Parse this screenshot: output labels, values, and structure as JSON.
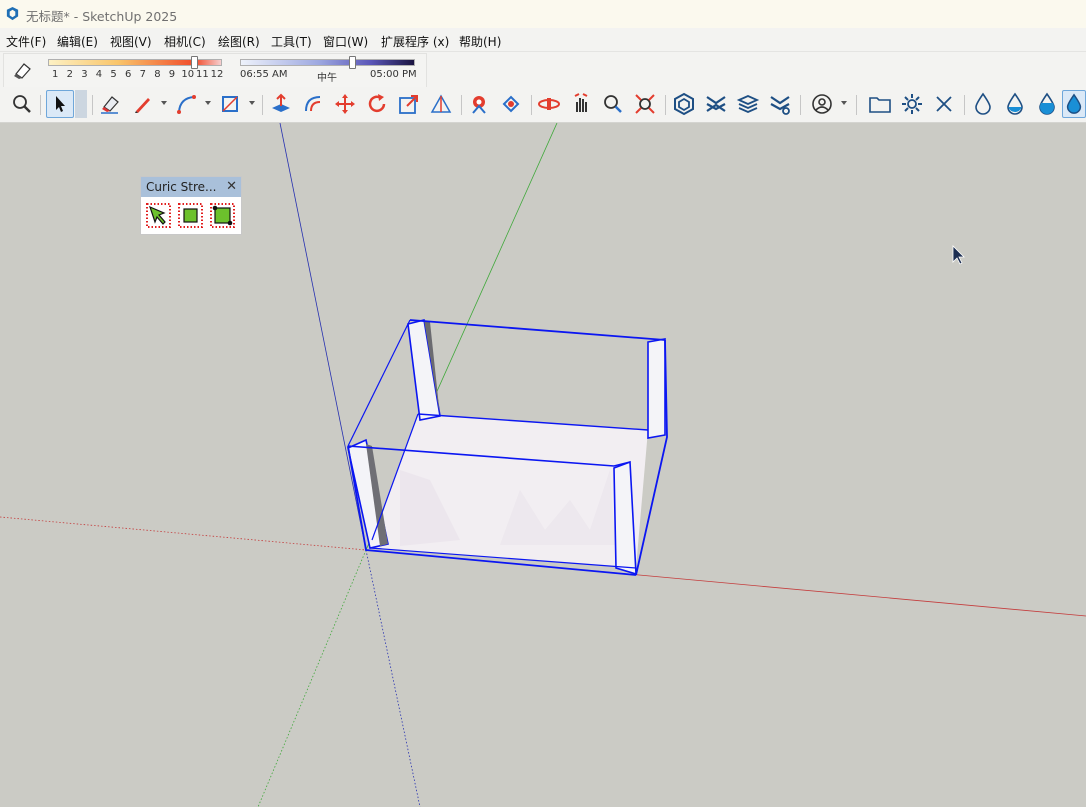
{
  "window": {
    "title": "无标题* - SketchUp 2025",
    "app_icon": "sketchup-logo-icon"
  },
  "menu": {
    "items": [
      {
        "label": "文件(F)"
      },
      {
        "label": "编辑(E)"
      },
      {
        "label": "视图(V)"
      },
      {
        "label": "相机(C)"
      },
      {
        "label": "绘图(R)"
      },
      {
        "label": "工具(T)"
      },
      {
        "label": "窗口(W)"
      },
      {
        "label": "扩展程序 (x)"
      },
      {
        "label": "帮助(H)"
      }
    ]
  },
  "shadow_settings": {
    "icon": "shadow-toggle-icon",
    "month_ticks": [
      "1",
      "2",
      "3",
      "4",
      "5",
      "6",
      "7",
      "8",
      "9",
      "10",
      "11",
      "12"
    ],
    "month_selected": 11,
    "time_start": "06:55 AM",
    "time_mid": "中午",
    "time_end": "05:00 PM",
    "time_position": 0.65,
    "colors": {
      "month_gradient_start": "#fdf1c4",
      "month_gradient_mid": "#f04a2a",
      "time_gradient_end": "#1a1440"
    }
  },
  "toolbar": {
    "tools": [
      "zoom-icon",
      "select-icon",
      "eraser-icon",
      "pencil-line-icon",
      "arc-icon",
      "rectangle-icon",
      "push-pull-icon",
      "offset-icon",
      "move-icon",
      "rotate-icon",
      "scale-icon",
      "protractor-icon",
      "paint-bucket-icon",
      "component-icon",
      "orbit-icon",
      "pan-icon",
      "zoom-window-icon",
      "zoom-extents-icon",
      "warehouse-icon",
      "extension-icon",
      "layers-icon",
      "outliner-icon",
      "profile-icon",
      "folder-icon",
      "gear-icon",
      "close-icon",
      "style-drop-1-icon",
      "style-drop-2-icon",
      "style-drop-3-icon",
      "style-drop-4-icon"
    ],
    "active_tool": "select-icon"
  },
  "curic_panel": {
    "title": "Curic Stre...",
    "buttons": [
      "stretch-select-icon",
      "stretch-box-icon",
      "stretch-corner-icon"
    ]
  },
  "scene": {
    "colors": {
      "selection": "#0b16f2",
      "axis_red": "#c43c3c",
      "axis_green": "#3fa83a",
      "axis_blue": "#2630b0",
      "background": "#cbcbc5"
    }
  }
}
